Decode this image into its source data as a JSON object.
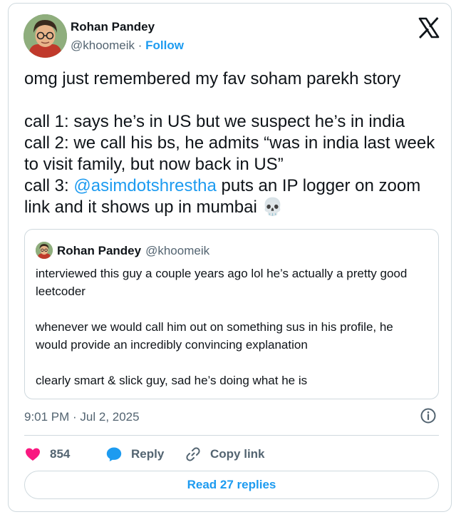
{
  "author": {
    "name": "Rohan Pandey",
    "handle": "@khoomeik",
    "separator": " · ",
    "follow_label": "Follow"
  },
  "tweet": {
    "line1": "omg just remembered my fav soham parekh story\n\ncall 1: says he’s in US but we suspect he’s in india\ncall 2: we call his bs, he admits “was in india last week to visit family, but now back in US”\ncall 3: ",
    "mention": "@asimdotshrestha",
    "line2": " puts an IP logger on zoom link and it shows up in mumbai ",
    "emoji": "💀"
  },
  "quote": {
    "name": "Rohan Pandey",
    "handle": "@khoomeik",
    "text": "interviewed this guy a couple years ago lol he’s actually a pretty good leetcoder\n\nwhenever we would call him out on something sus in his profile, he would provide an incredibly convincing explanation\n\nclearly smart & slick guy, sad he’s doing what he is"
  },
  "timestamp": "9:01 PM · Jul 2, 2025",
  "actions": {
    "likes": "854",
    "reply_label": "Reply",
    "copy_label": "Copy link"
  },
  "read_replies_label": "Read 27 replies",
  "colors": {
    "accent": "#1d9bf0",
    "like": "#f91880",
    "muted": "#536471",
    "border": "#cfd9de"
  }
}
